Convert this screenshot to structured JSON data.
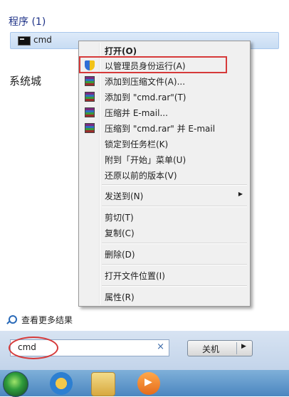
{
  "start_menu": {
    "programs_header": "程序 (1)",
    "result_item": "cmd",
    "pinned_label": "系统城",
    "see_more": "查看更多结果",
    "search": {
      "value": "cmd",
      "clear_glyph": "×"
    },
    "shutdown": {
      "label": "关机",
      "arrow": "▶"
    }
  },
  "context_menu": {
    "items": [
      {
        "label": "打开(O)",
        "icon": "none",
        "bold": true
      },
      {
        "label": "以管理员身份运行(A)",
        "icon": "uac-shield-icon"
      },
      {
        "label": "添加到压缩文件(A)...",
        "icon": "winrar-icon"
      },
      {
        "label": "添加到 \"cmd.rar\"(T)",
        "icon": "winrar-icon"
      },
      {
        "label": "压缩并 E-mail...",
        "icon": "winrar-icon"
      },
      {
        "label": "压缩到 \"cmd.rar\" 并 E-mail",
        "icon": "winrar-icon"
      },
      {
        "label": "锁定到任务栏(K)",
        "icon": "none"
      },
      {
        "label": "附到「开始」菜单(U)",
        "icon": "none"
      },
      {
        "label": "还原以前的版本(V)",
        "icon": "none"
      },
      {
        "label": "发送到(N)",
        "icon": "none",
        "submenu_glyph": "▶"
      },
      {
        "label": "剪切(T)",
        "icon": "none"
      },
      {
        "label": "复制(C)",
        "icon": "none"
      },
      {
        "label": "删除(D)",
        "icon": "none"
      },
      {
        "label": "打开文件位置(I)",
        "icon": "none"
      },
      {
        "label": "属性(R)",
        "icon": "none"
      }
    ]
  },
  "taskbar": {
    "icons": [
      "start-orb-icon",
      "internet-explorer-icon",
      "windows-explorer-icon",
      "media-player-icon"
    ]
  },
  "colors": {
    "highlight_red": "#d63a3a",
    "taskbar_blue": "#4b86c0",
    "menu_bg": "#f0f0f0"
  }
}
